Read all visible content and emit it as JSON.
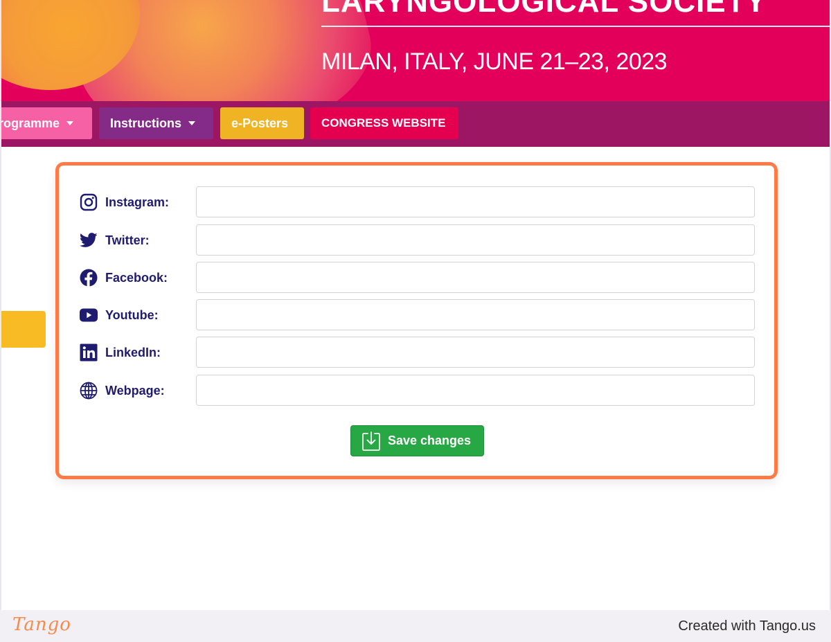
{
  "banner": {
    "title": "LARYNGOLOGICAL SOCIETY",
    "subtitle": "MILAN, ITALY, JUNE 21–23, 2023"
  },
  "nav": {
    "items": [
      {
        "label": "rogramme",
        "has_dropdown": true,
        "color": "#f661a6"
      },
      {
        "label": "Instructions",
        "has_dropdown": true,
        "color": "#842a87"
      },
      {
        "label": "e-Posters",
        "has_dropdown": false,
        "color": "#f0b324"
      },
      {
        "label": "CONGRESS WEBSITE",
        "has_dropdown": false,
        "color": "#e4004e"
      }
    ]
  },
  "form": {
    "fields": [
      {
        "icon": "instagram-icon",
        "label": "Instagram:",
        "value": "",
        "placeholder": ""
      },
      {
        "icon": "twitter-icon",
        "label": "Twitter:",
        "value": "",
        "placeholder": ""
      },
      {
        "icon": "facebook-icon",
        "label": "Facebook:",
        "value": "",
        "placeholder": ""
      },
      {
        "icon": "youtube-icon",
        "label": "Youtube:",
        "value": "",
        "placeholder": ""
      },
      {
        "icon": "linkedin-icon",
        "label": "LinkedIn:",
        "value": "",
        "placeholder": ""
      },
      {
        "icon": "globe-icon",
        "label": "Webpage:",
        "value": "",
        "placeholder": ""
      }
    ],
    "save_label": "Save changes",
    "save_icon": "download-box-icon"
  },
  "footer": {
    "logo": "Tango",
    "credit": "Created with Tango.us"
  },
  "colors": {
    "highlight": "#ff7a45",
    "label_text": "#1f1b6e",
    "save_button": "#28a745",
    "banner": "#e3005a",
    "nav_bar": "#9c1664"
  }
}
